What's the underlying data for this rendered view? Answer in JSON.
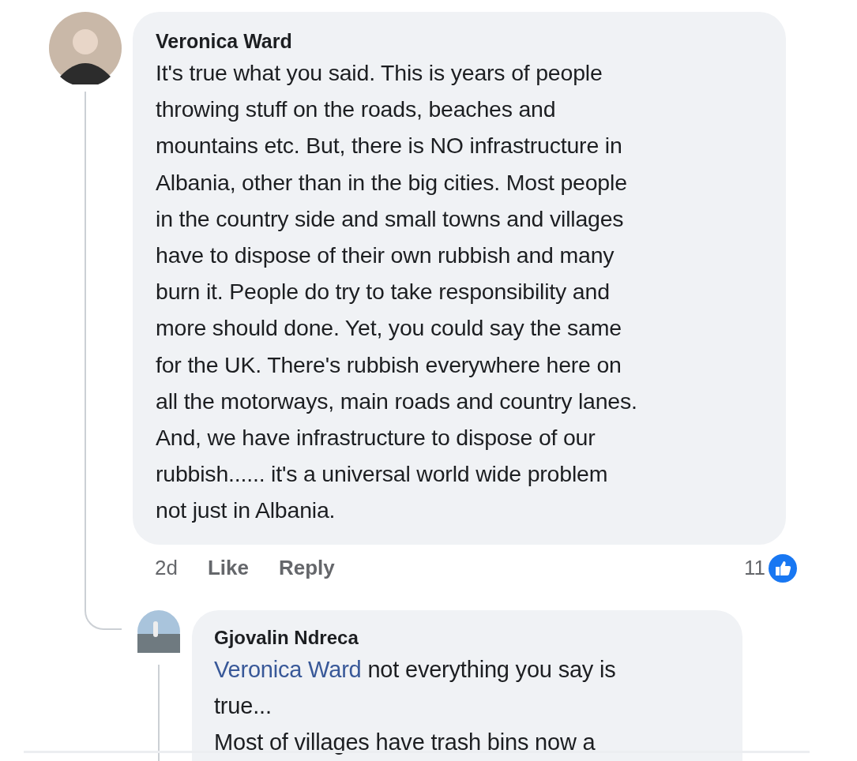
{
  "comment": {
    "author": "Veronica Ward",
    "body": "It's true what you said. This is years of people\nthrowing stuff on the roads, beaches and\nmountains etc. But, there is NO infrastructure in\nAlbania, other than in the big cities. Most people\nin the country side and small towns and villages\nhave to dispose of their own rubbish and many\nburn it. People do try to take responsibility and\nmore should done. Yet, you could say the same\nfor the UK. There's rubbish everywhere here on\nall the motorways, main roads and country lanes.\nAnd, we have infrastructure to dispose of our\nrubbish...... it's a universal world wide problem\nnot just in Albania.",
    "time": "2d",
    "actions": [
      "Like",
      "Reply"
    ],
    "reaction_count": "11"
  },
  "reply": {
    "author": "Gjovalin Ndreca",
    "mention": "Veronica Ward",
    "body": " not everything you say is\ntrue...\nMost of villages have trash bins now a"
  }
}
